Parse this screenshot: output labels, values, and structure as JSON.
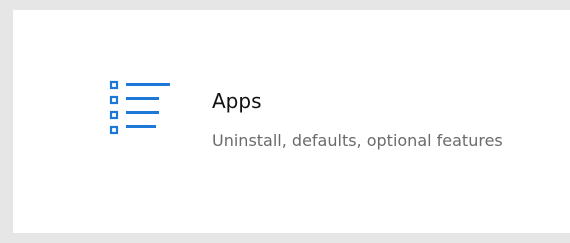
{
  "tile": {
    "title": "Apps",
    "description": "Uninstall, defaults, optional features",
    "icon": "apps-list-icon",
    "accent_color": "#1e78d8"
  }
}
